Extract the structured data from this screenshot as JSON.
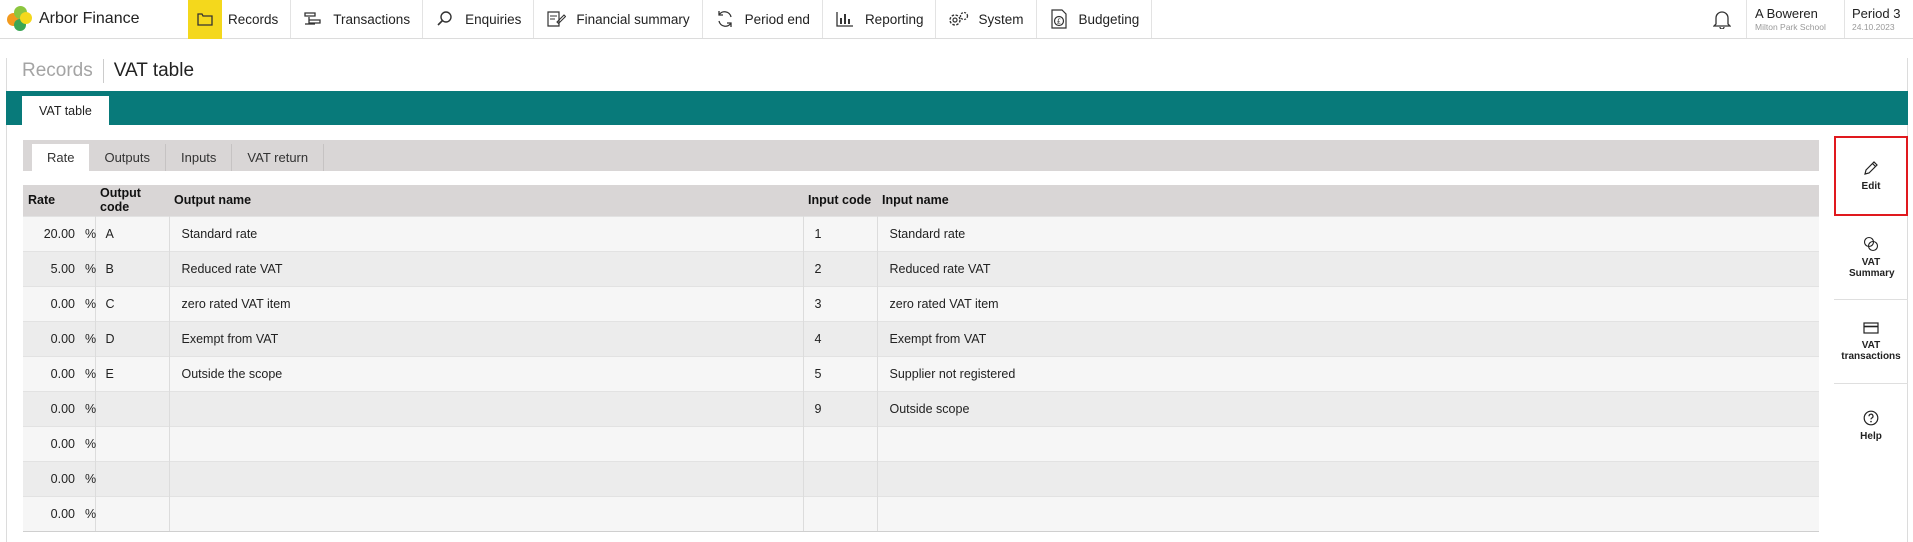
{
  "app": {
    "name": "Arbor Finance"
  },
  "nav": [
    {
      "label": "Records",
      "icon": "records-icon",
      "active": true
    },
    {
      "label": "Transactions",
      "icon": "transactions-icon"
    },
    {
      "label": "Enquiries",
      "icon": "search-icon"
    },
    {
      "label": "Financial summary",
      "icon": "financial-summary-icon"
    },
    {
      "label": "Period end",
      "icon": "period-end-icon"
    },
    {
      "label": "Reporting",
      "icon": "reporting-icon"
    },
    {
      "label": "System",
      "icon": "system-icon"
    },
    {
      "label": "Budgeting",
      "icon": "budgeting-icon"
    }
  ],
  "user": {
    "name": "A Boweren",
    "school": "Milton Park School"
  },
  "period": {
    "label": "Period 3",
    "date": "24.10.2023"
  },
  "breadcrumb": {
    "root": "Records",
    "current": "VAT table"
  },
  "page_tab": "VAT table",
  "subtabs": [
    "Rate",
    "Outputs",
    "Inputs",
    "VAT return"
  ],
  "table": {
    "headers": [
      "Rate",
      "Output code",
      "Output name",
      "Input code",
      "Input name"
    ],
    "percent_symbol": "%",
    "rows": [
      {
        "rate": "20.00",
        "output_code": "A",
        "output_name": "Standard rate",
        "input_code": "1",
        "input_name": "Standard rate"
      },
      {
        "rate": "5.00",
        "output_code": "B",
        "output_name": "Reduced rate VAT",
        "input_code": "2",
        "input_name": "Reduced rate VAT"
      },
      {
        "rate": "0.00",
        "output_code": "C",
        "output_name": "zero rated VAT item",
        "input_code": "3",
        "input_name": "zero rated VAT item"
      },
      {
        "rate": "0.00",
        "output_code": "D",
        "output_name": "Exempt from VAT",
        "input_code": "4",
        "input_name": "Exempt from VAT"
      },
      {
        "rate": "0.00",
        "output_code": "E",
        "output_name": "Outside the scope",
        "input_code": "5",
        "input_name": "Supplier not registered"
      },
      {
        "rate": "0.00",
        "output_code": "",
        "output_name": "",
        "input_code": "9",
        "input_name": "Outside scope"
      },
      {
        "rate": "0.00",
        "output_code": "",
        "output_name": "",
        "input_code": "",
        "input_name": ""
      },
      {
        "rate": "0.00",
        "output_code": "",
        "output_name": "",
        "input_code": "",
        "input_name": ""
      },
      {
        "rate": "0.00",
        "output_code": "",
        "output_name": "",
        "input_code": "",
        "input_name": ""
      }
    ]
  },
  "actions": [
    {
      "label": "Edit",
      "icon": "pencil-icon",
      "highlighted": true
    },
    {
      "label": "VAT Summary",
      "icon": "vat-summary-icon"
    },
    {
      "label": "VAT transactions",
      "icon": "card-icon"
    },
    {
      "label": "Help",
      "icon": "help-icon"
    }
  ],
  "colors": {
    "teal": "#087a7a",
    "active_nav": "#f4d81c",
    "highlight": "#e0191e"
  }
}
